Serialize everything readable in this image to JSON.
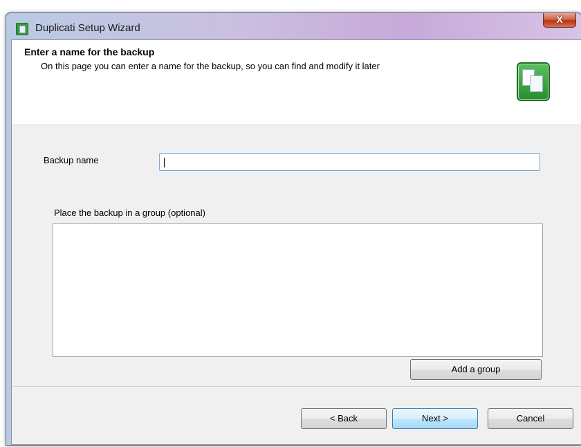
{
  "window": {
    "title": "Duplicati Setup Wizard",
    "close_label": "X"
  },
  "header": {
    "title": "Enter a name for the backup",
    "description": "On this page you can enter a name for the backup, so you can find and modify it later"
  },
  "form": {
    "backup_name_label": "Backup name",
    "backup_name_value": "",
    "group_label": "Place the backup in a group (optional)",
    "add_group_label": "Add a group"
  },
  "footer": {
    "back_label": "< Back",
    "next_label": "Next >",
    "cancel_label": "Cancel"
  },
  "colors": {
    "accent": "#3c7fb1",
    "header_icon": "#3a9b3e"
  }
}
